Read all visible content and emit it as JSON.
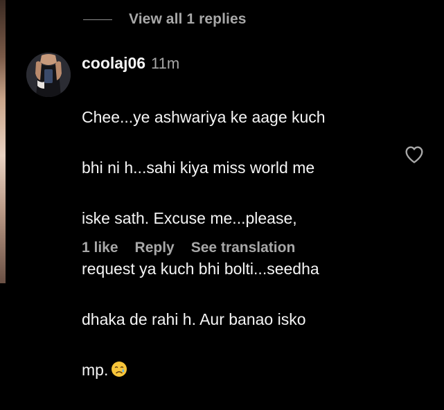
{
  "replies": {
    "view_label": "View all 1 replies"
  },
  "comment": {
    "username": "coolaj06",
    "time": "11m",
    "lines": [
      "Chee...ye ashwariya ke aage kuch",
      "bhi ni h...sahi kiya miss world me",
      "iske sath. Excuse me...please,",
      "request ya kuch bhi bolti...seedha",
      "dhaka de rahi h. Aur banao isko",
      "mp."
    ],
    "emoji": "crying-face-emoji"
  },
  "actions": {
    "likes": "1 like",
    "reply": "Reply",
    "translate": "See translation"
  },
  "icons": {
    "like": "heart-outline-icon"
  },
  "colors": {
    "background": "#000000",
    "primary_text": "#f5f5f5",
    "secondary_text": "#a8a8a8"
  }
}
